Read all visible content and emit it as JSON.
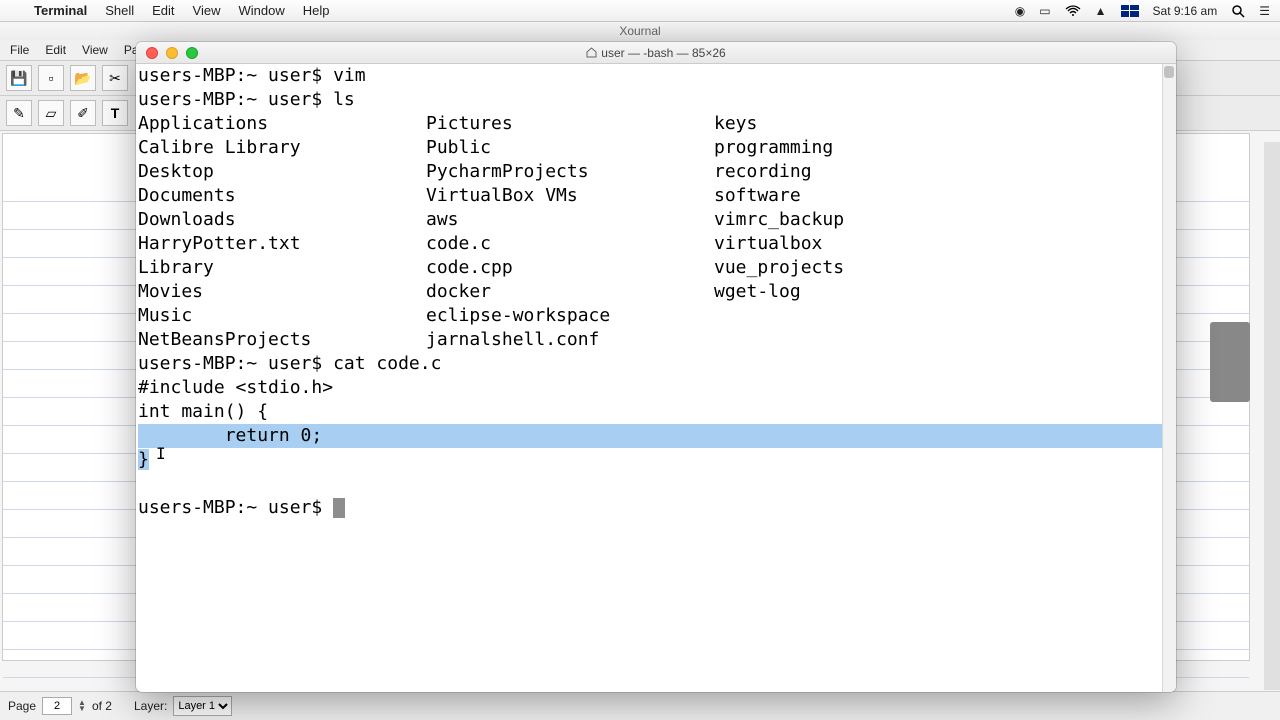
{
  "menubar": {
    "app": "Terminal",
    "items": [
      "Shell",
      "Edit",
      "View",
      "Window",
      "Help"
    ],
    "clock": "Sat 9:16 am"
  },
  "xournal": {
    "title": "Xournal",
    "menu": [
      "File",
      "Edit",
      "View",
      "Pa"
    ],
    "status": {
      "page_label": "Page",
      "page_num": "2",
      "page_of": "of 2",
      "layer_label": "Layer:",
      "layer": "Layer 1"
    }
  },
  "terminal": {
    "title": "user — -bash — 85×26",
    "prompt1": "users-MBP:~ user$ vim",
    "prompt2": "users-MBP:~ user$ ls",
    "ls_rows": [
      [
        "Applications",
        "Pictures",
        "keys"
      ],
      [
        "Calibre Library",
        "Public",
        "programming"
      ],
      [
        "Desktop",
        "PycharmProjects",
        "recording"
      ],
      [
        "Documents",
        "VirtualBox VMs",
        "software"
      ],
      [
        "Downloads",
        "aws",
        "vimrc_backup"
      ],
      [
        "HarryPotter.txt",
        "code.c",
        "virtualbox"
      ],
      [
        "Library",
        "code.cpp",
        "vue_projects"
      ],
      [
        "Movies",
        "docker",
        "wget-log"
      ],
      [
        "Music",
        "eclipse-workspace",
        ""
      ],
      [
        "NetBeansProjects",
        "jarnalshell.conf",
        ""
      ]
    ],
    "prompt3": "users-MBP:~ user$ cat code.c",
    "code_line1": "#include <stdio.h>",
    "code_blank": "",
    "code_line2": "int main() {",
    "code_line3": "        return 0;",
    "code_line4": "}",
    "prompt4": "users-MBP:~ user$ "
  }
}
